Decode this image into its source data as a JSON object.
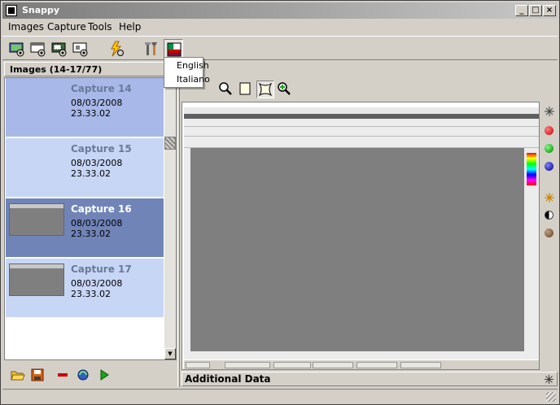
{
  "window": {
    "title": "Snappy"
  },
  "menubar": {
    "items": [
      "Images",
      "Capture",
      "Tools",
      "Help"
    ]
  },
  "language_menu": {
    "options": [
      "English",
      "Italiano"
    ]
  },
  "images_panel": {
    "header": "Images (14-17/77)",
    "captures": [
      {
        "name": "Capture 14",
        "date": "08/03/2008 23.33.02",
        "selected": false,
        "has_thumbnail": false
      },
      {
        "name": "Capture 15",
        "date": "08/03/2008 23.33.02",
        "selected": false,
        "has_thumbnail": false
      },
      {
        "name": "Capture 16",
        "date": "08/03/2008 23.33.02",
        "selected": true,
        "has_thumbnail": true
      },
      {
        "name": "Capture 17",
        "date": "08/03/2008 23.33.02",
        "selected": false,
        "has_thumbnail": true
      }
    ]
  },
  "additional_data": {
    "title": "Additional Data"
  },
  "colors": {
    "title_gradient_start": "#7b7b7b",
    "list_item_bg": "#c8d6f6",
    "selected_bg": "#7084b8",
    "capture_name": "#6b7a9a"
  },
  "icons": {
    "toolbar": [
      "capture-screen-icon",
      "capture-window-icon",
      "capture-region-icon",
      "capture-object-icon",
      "quick-capture-icon",
      "settings-tools-icon",
      "language-flag-icon"
    ],
    "left_bottom": [
      "open-folder-icon",
      "save-icon",
      "delete-icon",
      "refresh-icon",
      "play-icon"
    ],
    "right_toolbar": [
      "save-image-icon",
      "zoom-icon",
      "fit-icon",
      "stretch-icon",
      "zoom-in-icon"
    ]
  }
}
